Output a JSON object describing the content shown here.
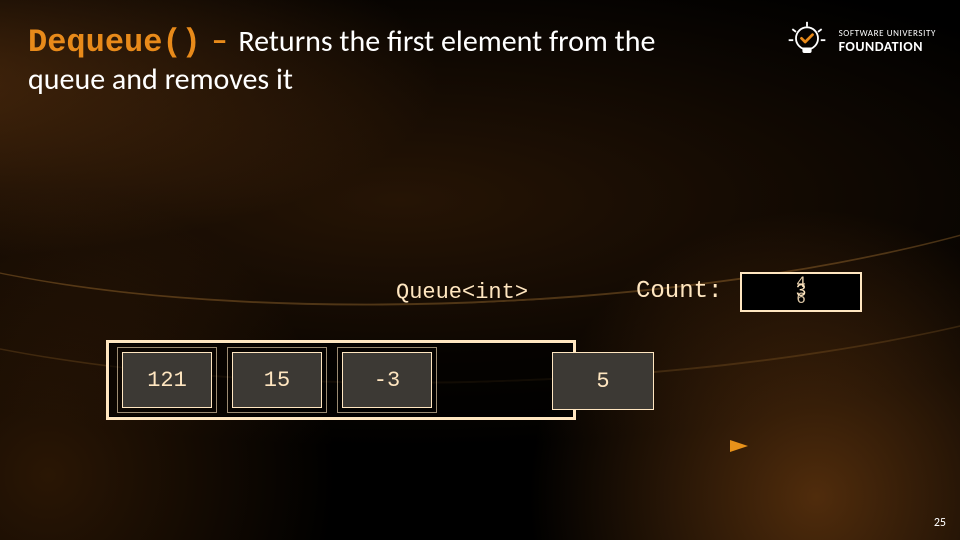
{
  "title": {
    "keyword": "Dequeue()",
    "dash": "–",
    "rest1": "Returns the first element from the",
    "rest2": "queue and removes it"
  },
  "logo": {
    "line1": "SOFTWARE UNIVERSITY",
    "line2": "FOUNDATION"
  },
  "labels": {
    "queue_type": "Queue<int>",
    "count": "Count:"
  },
  "count_box": {
    "top": "4",
    "mid": "3",
    "bot": "6"
  },
  "queue_cells": [
    "121",
    "15",
    "-3"
  ],
  "overflow_cell": "5",
  "colors": {
    "accent": "#e88a1a",
    "mono": "#ffe6c0"
  },
  "page_number": "25"
}
